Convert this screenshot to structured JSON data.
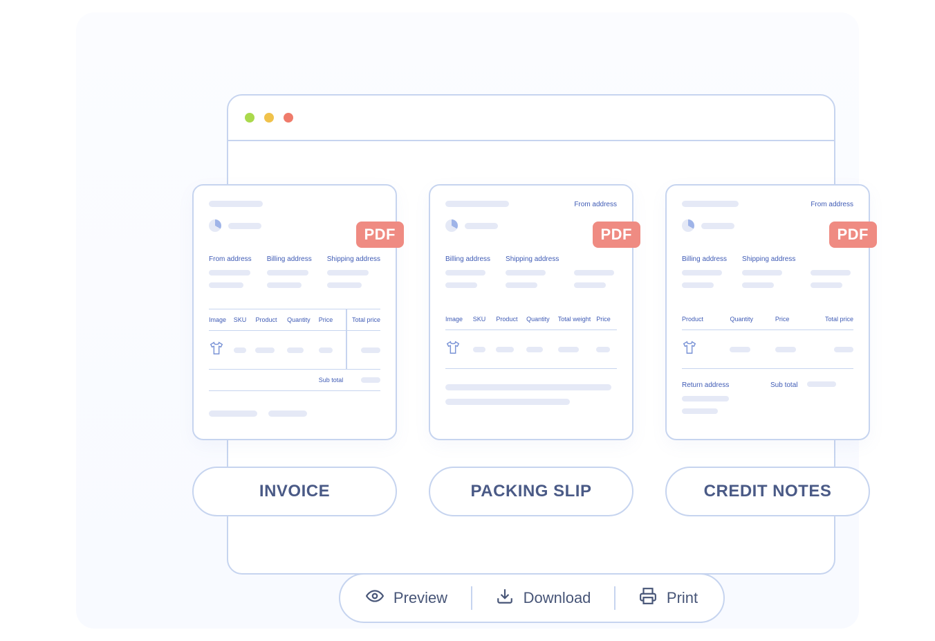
{
  "badge": "PDF",
  "documents": {
    "invoice": {
      "pill": "INVOICE",
      "addresses": [
        "From address",
        "Billing address",
        "Shipping address"
      ],
      "columns": [
        "Image",
        "SKU",
        "Product",
        "Quantity",
        "Price",
        "Total price"
      ],
      "subtotal_label": "Sub total"
    },
    "packing": {
      "pill": "PACKING SLIP",
      "top_right": "From address",
      "addresses": [
        "Billing address",
        "Shipping address"
      ],
      "columns": [
        "Image",
        "SKU",
        "Product",
        "Quantity",
        "Total weight",
        "Price"
      ]
    },
    "credit": {
      "pill": "CREDIT NOTES",
      "top_right": "From address",
      "addresses": [
        "Billing address",
        "Shipping address"
      ],
      "columns": [
        "Product",
        "Quantity",
        "Price",
        "Total price"
      ],
      "return_label": "Return address",
      "subtotal_label": "Sub total"
    }
  },
  "actions": {
    "preview": "Preview",
    "download": "Download",
    "print": "Print"
  }
}
